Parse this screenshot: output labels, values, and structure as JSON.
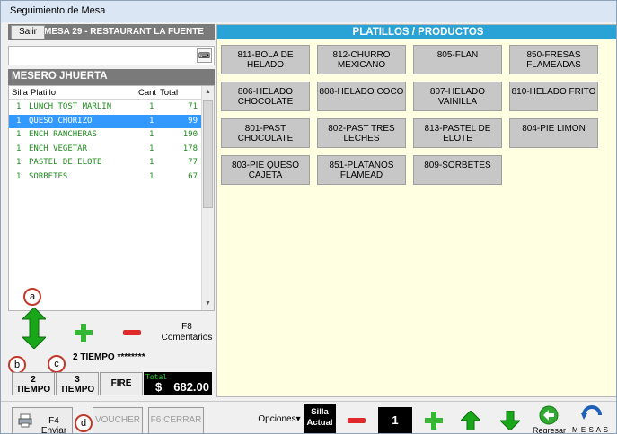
{
  "window": {
    "title": "Seguimiento de Mesa"
  },
  "leftpane": {
    "salir_label": "Salir",
    "header_title": "MESA 29 - RESTAURANT LA FUENTE",
    "mesero": "MESERO JHUERTA",
    "columns": [
      "Silla",
      "Platillo",
      "Cant",
      "Total"
    ],
    "rows": [
      {
        "silla": "1",
        "platillo": "LUNCH TOST MARLIN",
        "cant": "1",
        "total": "71",
        "selected": false
      },
      {
        "silla": "1",
        "platillo": "QUESO CHORIZO",
        "cant": "1",
        "total": "99",
        "selected": true
      },
      {
        "silla": "1",
        "platillo": "ENCH RANCHERAS",
        "cant": "1",
        "total": "190",
        "selected": false
      },
      {
        "silla": "1",
        "platillo": "ENCH VEGETAR",
        "cant": "1",
        "total": "178",
        "selected": false
      },
      {
        "silla": "1",
        "platillo": "PASTEL DE ELOTE",
        "cant": "1",
        "total": "77",
        "selected": false
      },
      {
        "silla": "1",
        "platillo": "SORBETES",
        "cant": "1",
        "total": "67",
        "selected": false
      }
    ]
  },
  "controls": {
    "marker_a": "a",
    "marker_b": "b",
    "marker_c": "c",
    "marker_d": "d",
    "f8_label": "F8 Comentarios",
    "tiempo_status": "2 TIEMPO ********",
    "tiempo2_label": "2 TIEMPO",
    "tiempo3_label": "3 TIEMPO",
    "fire_label": "FIRE",
    "total_label": "Total",
    "total_currency": "$",
    "total_value": "682.00"
  },
  "rightpane": {
    "header": "PLATILLOS / PRODUCTOS",
    "products": [
      "811-BOLA DE HELADO",
      "812-CHURRO MEXICANO",
      "805-FLAN",
      "850-FRESAS FLAMEADAS",
      "806-HELADO CHOCOLATE",
      "808-HELADO COCO",
      "807-HELADO VAINILLA",
      "810-HELADO FRITO",
      "801-PAST CHOCOLATE",
      "802-PAST TRES LECHES",
      "813-PASTEL DE ELOTE",
      "804-PIE LIMON",
      "803-PIE QUESO CAJETA",
      "851-PLATANOS FLAMEAD",
      "809-SORBETES"
    ]
  },
  "bottombar": {
    "enviar_label": "F4 Enviar",
    "voucher_label": "VOUCHER",
    "cerrar_label": "F6 CERRAR",
    "opciones_label": "Opciones",
    "silla_label": "Silla Actual",
    "seat_number": "1",
    "regresar_label": "Regresar",
    "mesas_label": "M E S A S"
  },
  "colors": {
    "accent_blue": "#29a3d6",
    "item_green": "#1f8a1f",
    "selection": "#3399ff",
    "panel_yellow": "#ffffe1"
  }
}
